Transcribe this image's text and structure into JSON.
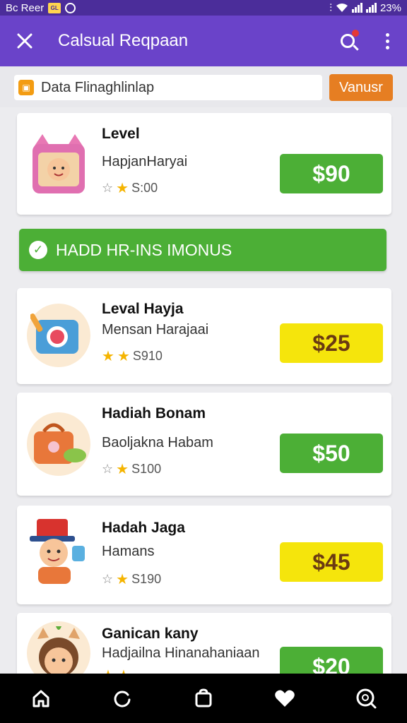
{
  "status_bar": {
    "left_text": "Bc Reer",
    "badge": "GL",
    "battery": "23%"
  },
  "app_bar": {
    "title": "Calsual Reqpaan"
  },
  "filter": {
    "label": "Data Flinaghlinlap",
    "button": "Vanusr"
  },
  "banner": {
    "text": "HADD HR-INS IMONUS"
  },
  "cards": [
    {
      "title": "Level",
      "subtitle": "HapjanHaryai",
      "meta": "S:00",
      "price": "$90",
      "price_color": "#4caf36"
    },
    {
      "title": "Leval Hayja",
      "subtitle": "Mensan Harajaai",
      "meta": "S910",
      "price": "$25",
      "price_color": "#f5e50c"
    },
    {
      "title": "Hadiah Bonam",
      "subtitle": "Baoljakna Habam",
      "meta": "S100",
      "price": "$50",
      "price_color": "#4caf36"
    },
    {
      "title": "Hadah Jaga",
      "subtitle": "Hamans",
      "meta": "S190",
      "price": "$45",
      "price_color": "#f5e50c"
    },
    {
      "title": "Ganican kany",
      "subtitle": "Hadjailna Hinanahaniaan",
      "meta": "",
      "price": "$20",
      "price_color": "#4caf36"
    }
  ],
  "bottom_nav": [
    "home-icon",
    "refresh-icon",
    "bag-icon",
    "heart-icon",
    "search-icon"
  ],
  "colors": {
    "status_bar": "#4b2d9a",
    "app_bar": "#6a43c9",
    "green": "#4caf36",
    "yellow": "#f5e50c",
    "orange": "#e67e22"
  }
}
